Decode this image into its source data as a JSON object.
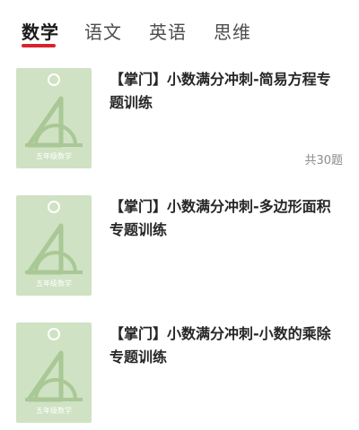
{
  "tabs": [
    {
      "label": "数学",
      "active": true
    },
    {
      "label": "语文",
      "active": false
    },
    {
      "label": "英语",
      "active": false
    },
    {
      "label": "思维",
      "active": false
    }
  ],
  "colors": {
    "tab_indicator": "#d6242e",
    "cover_bg": "#cfe2c3",
    "cover_art": "#a9c896"
  },
  "items": [
    {
      "title": "【掌门】小数满分冲刺-简易方程专题训练",
      "cover_caption": "五年级数学",
      "cover_icon": "triangle-ruler-protractor-icon",
      "question_count": "共30题"
    },
    {
      "title": "【掌门】小数满分冲刺-多边形面积专题训练",
      "cover_caption": "五年级数学",
      "cover_icon": "triangle-ruler-protractor-icon"
    },
    {
      "title": "【掌门】小数满分冲刺-小数的乘除专题训练",
      "cover_caption": "五年级数学",
      "cover_icon": "triangle-ruler-protractor-icon"
    }
  ]
}
